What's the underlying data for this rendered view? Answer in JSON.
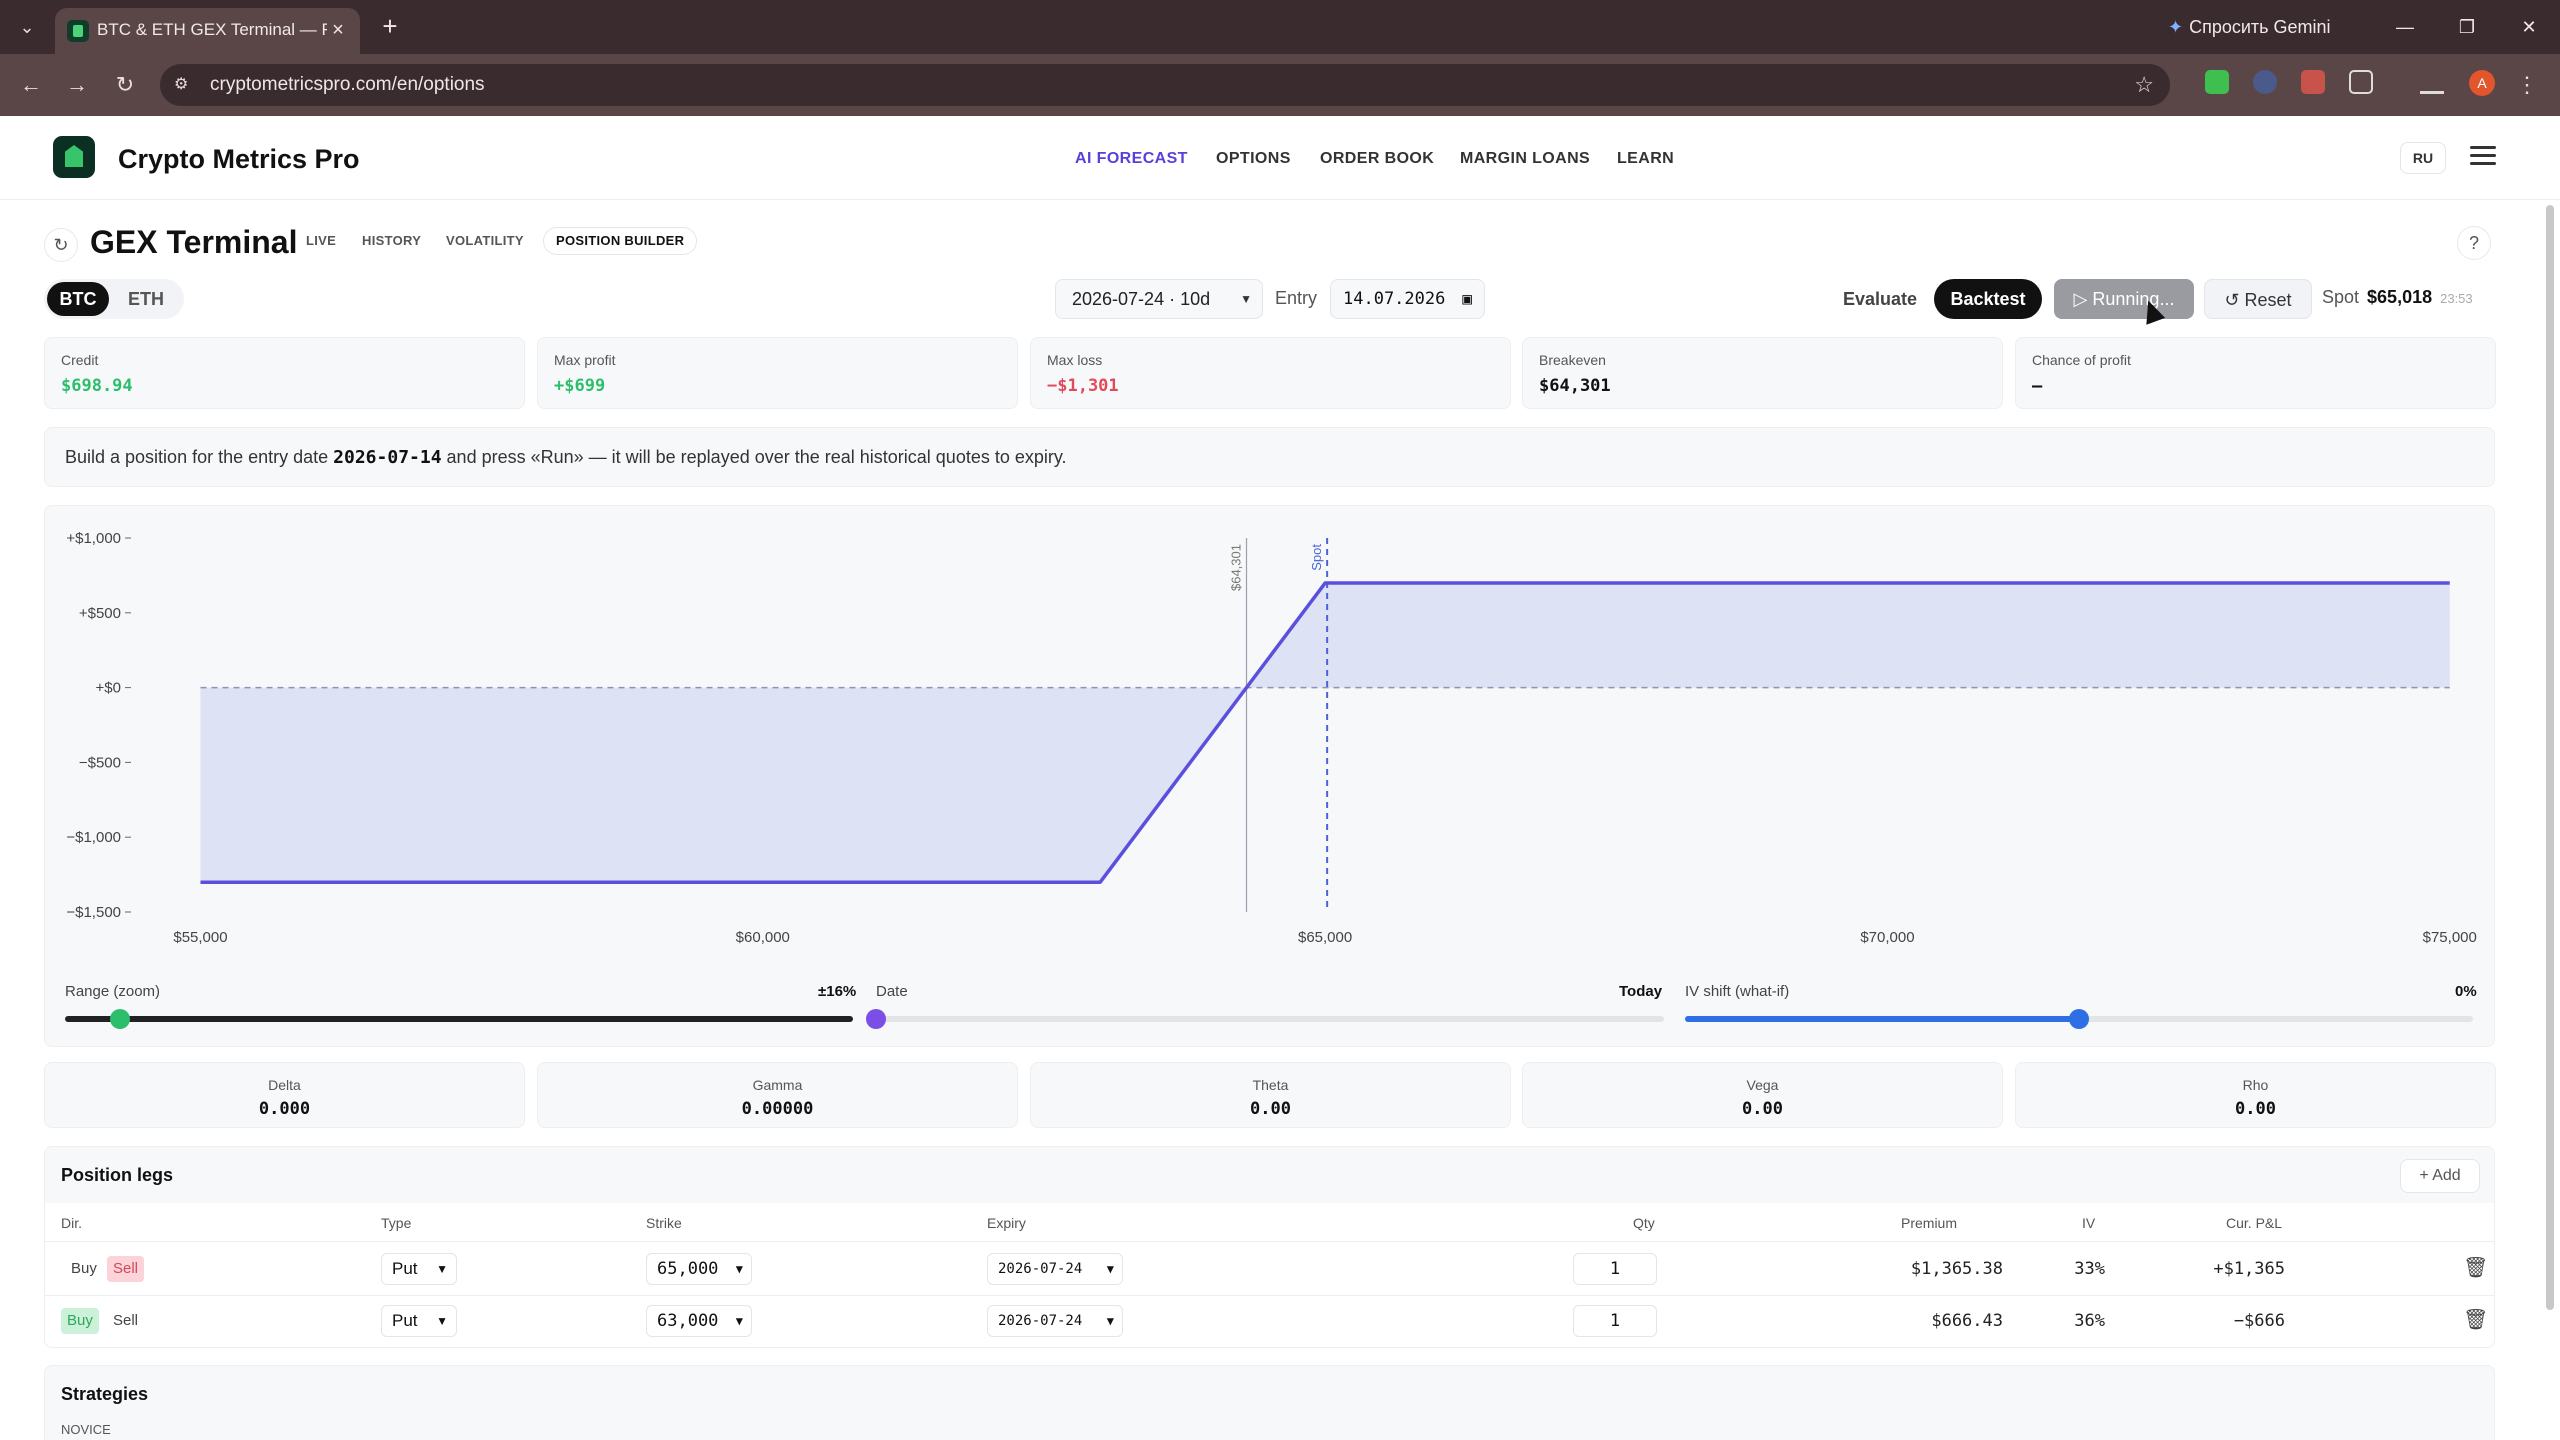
{
  "browser": {
    "tab_title": "BTC & ETH GEX Terminal — Fre",
    "url": "cryptometricspro.com/en/options",
    "gemini_label": "Спросить Gemini",
    "profile_initial": "A"
  },
  "header": {
    "brand": "Crypto Metrics Pro",
    "nav": [
      "AI FORECAST",
      "OPTIONS",
      "ORDER BOOK",
      "MARGIN LOANS",
      "LEARN"
    ],
    "nav_active": "AI FORECAST",
    "lang": "RU"
  },
  "terminal": {
    "title": "GEX Terminal",
    "tabs": [
      "LIVE",
      "HISTORY",
      "VOLATILITY",
      "POSITION BUILDER"
    ],
    "active_tab": "POSITION BUILDER",
    "assets": [
      "BTC",
      "ETH"
    ],
    "active_asset": "BTC",
    "expiry_select": "2026-07-24 · 10d",
    "entry_label": "Entry",
    "entry_date": "14.07.2026",
    "evaluate_label": "Evaluate",
    "backtest_label": "Backtest",
    "running_label": "Running...",
    "reset_label": "Reset",
    "spot_label": "Spot",
    "spot_value": "$65,018",
    "spot_time": "23:53"
  },
  "stats": [
    {
      "label": "Credit",
      "value": "$698.94",
      "tone": "green"
    },
    {
      "label": "Max profit",
      "value": "+$699",
      "tone": "green"
    },
    {
      "label": "Max loss",
      "value": "−$1,301",
      "tone": "red"
    },
    {
      "label": "Breakeven",
      "value": "$64,301",
      "tone": "dark"
    },
    {
      "label": "Chance of profit",
      "value": "–",
      "tone": "dark"
    }
  ],
  "info": {
    "prefix": "Build a position for the entry date ",
    "date": "2026-07-14",
    "suffix": " and press «Run» — it will be replayed over the real historical quotes to expiry."
  },
  "chart_data": {
    "type": "area",
    "x": [
      55000,
      63000,
      65000,
      75000
    ],
    "y": [
      -1301,
      -1301,
      699,
      699
    ],
    "xlim": [
      54400,
      75100
    ],
    "ylim": [
      -1500,
      1000
    ],
    "y_ticks": [
      1000,
      500,
      0,
      -500,
      -1000,
      -1500
    ],
    "y_tick_labels": [
      "+$1,000",
      "+$500",
      "+$0",
      "−$500",
      "−$1,000",
      "−$1,500"
    ],
    "x_ticks": [
      55000,
      60000,
      65000,
      70000,
      75000
    ],
    "x_tick_labels": [
      "$55,000",
      "$60,000",
      "$65,000",
      "$70,000",
      "$75,000"
    ],
    "markers": [
      {
        "label": "$64,301",
        "x": 64301,
        "style": "solid"
      },
      {
        "label": "Spot",
        "x": 65018,
        "style": "dashed"
      }
    ],
    "grid": false,
    "line_color": "#5b4fdc",
    "fill_color": "#dde2f4"
  },
  "sliders": {
    "range_label": "Range (zoom)",
    "range_value": "±16%",
    "range_level": 0.07,
    "date_label": "Date",
    "date_value": "Today",
    "date_level": 0.0,
    "iv_label": "IV shift (what-if)",
    "iv_value": "0%",
    "iv_level": 0.5
  },
  "greeks": [
    {
      "label": "Delta",
      "value": "0.000"
    },
    {
      "label": "Gamma",
      "value": "0.00000"
    },
    {
      "label": "Theta",
      "value": "0.00"
    },
    {
      "label": "Vega",
      "value": "0.00"
    },
    {
      "label": "Rho",
      "value": "0.00"
    }
  ],
  "legs": {
    "title": "Position legs",
    "add_label": "Add",
    "columns": [
      "Dir.",
      "Type",
      "Strike",
      "Expiry",
      "Qty",
      "Premium",
      "IV",
      "Cur. P&L"
    ],
    "buy_label": "Buy",
    "sell_label": "Sell",
    "rows": [
      {
        "dir": "Sell",
        "type": "Put",
        "strike": "65,000",
        "expiry": "2026-07-24",
        "qty": "1",
        "premium": "$1,365.38",
        "iv": "33%",
        "pnl": "+$1,365",
        "pnl_tone": "green"
      },
      {
        "dir": "Buy",
        "type": "Put",
        "strike": "63,000",
        "expiry": "2026-07-24",
        "qty": "1",
        "premium": "$666.43",
        "iv": "36%",
        "pnl": "−$666",
        "pnl_tone": "red"
      }
    ]
  },
  "strategies": {
    "title": "Strategies",
    "level": "NOVICE"
  }
}
